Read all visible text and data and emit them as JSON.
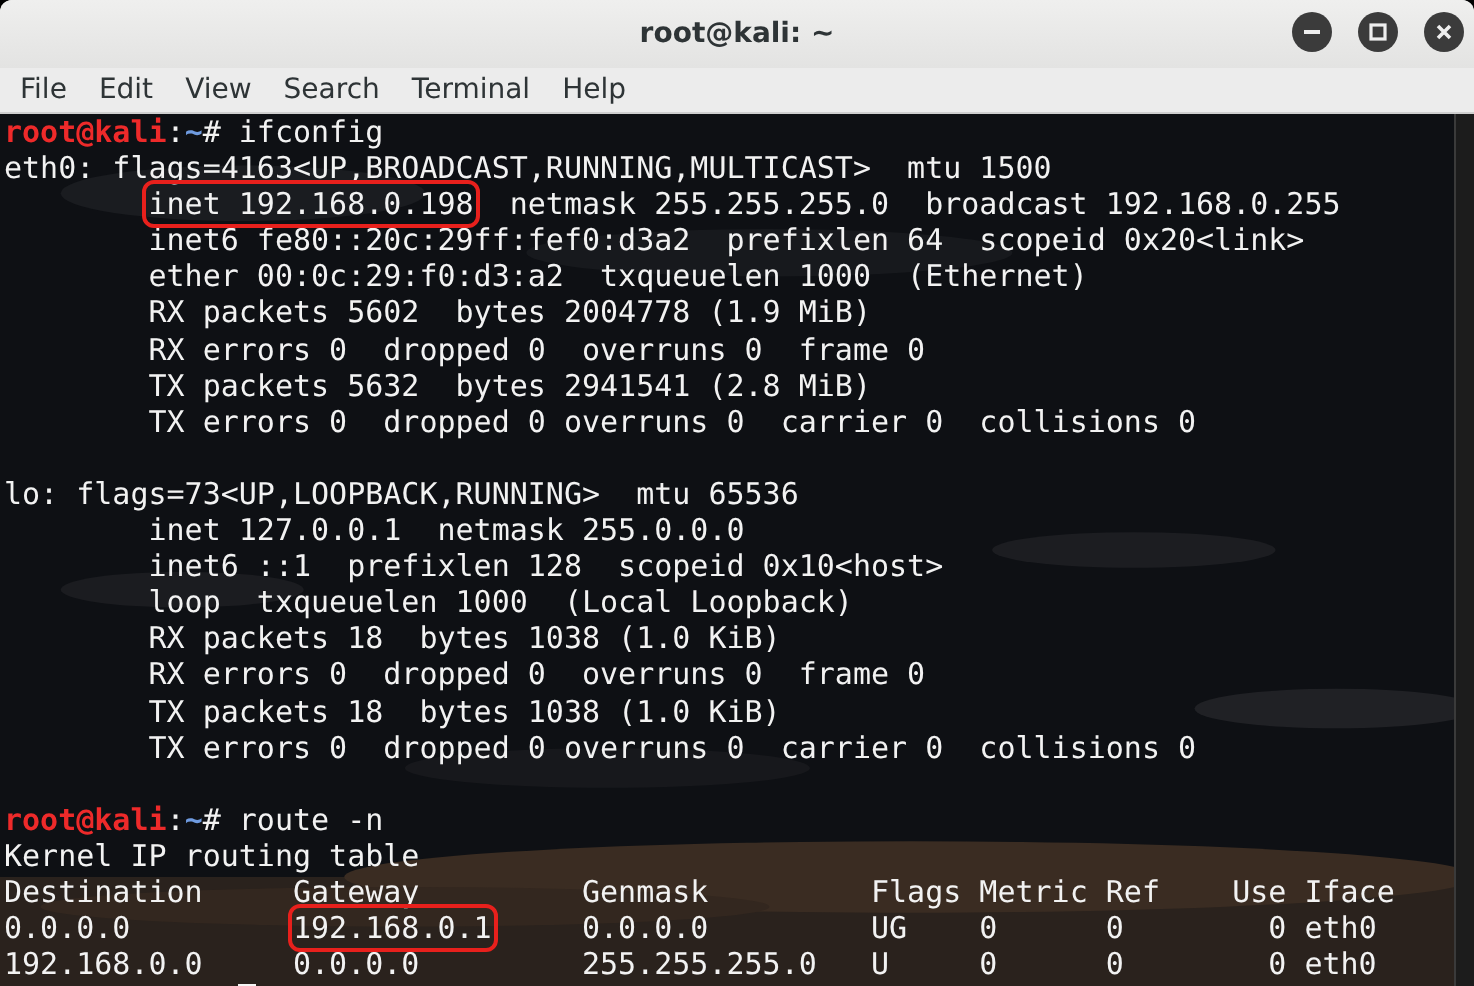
{
  "window": {
    "title": "root@kali: ~"
  },
  "menu": [
    "File",
    "Edit",
    "View",
    "Search",
    "Terminal",
    "Help"
  ],
  "terminal": {
    "lines": [
      {
        "kind": "text",
        "parts": [
          {
            "text": "root@kali",
            "color": "#ee2a2a"
          },
          {
            "text": ":"
          },
          {
            "text": "~",
            "color": "#6f9be0"
          },
          {
            "text": "# ifconfig"
          }
        ]
      },
      {
        "kind": "text",
        "parts": [
          {
            "text": "eth0: flags=4163<UP,BROADCAST,RUNNING,MULTICAST>  mtu 1500"
          }
        ]
      },
      {
        "kind": "text",
        "indented": true,
        "parts": [
          {
            "text": "inet 192.168.0.198",
            "boxed": true
          },
          {
            "text": "  netmask 255.255.255.0  broadcast 192.168.0.255"
          }
        ]
      },
      {
        "kind": "text",
        "parts": [
          {
            "text": "        inet6 fe80::20c:29ff:fef0:d3a2  prefixlen 64  scopeid 0x20<link>"
          }
        ]
      },
      {
        "kind": "text",
        "parts": [
          {
            "text": "        ether 00:0c:29:f0:d3:a2  txqueuelen 1000  (Ethernet)"
          }
        ]
      },
      {
        "kind": "text",
        "parts": [
          {
            "text": "        RX packets 5602  bytes 2004778 (1.9 MiB)"
          }
        ]
      },
      {
        "kind": "text",
        "parts": [
          {
            "text": "        RX errors 0  dropped 0  overruns 0  frame 0"
          }
        ]
      },
      {
        "kind": "text",
        "parts": [
          {
            "text": "        TX packets 5632  bytes 2941541 (2.8 MiB)"
          }
        ]
      },
      {
        "kind": "text",
        "parts": [
          {
            "text": "        TX errors 0  dropped 0 overruns 0  carrier 0  collisions 0"
          }
        ]
      },
      {
        "kind": "blank"
      },
      {
        "kind": "text",
        "parts": [
          {
            "text": "lo: flags=73<UP,LOOPBACK,RUNNING>  mtu 65536"
          }
        ]
      },
      {
        "kind": "text",
        "parts": [
          {
            "text": "        inet 127.0.0.1  netmask 255.0.0.0"
          }
        ]
      },
      {
        "kind": "text",
        "parts": [
          {
            "text": "        inet6 ::1  prefixlen 128  scopeid 0x10<host>"
          }
        ]
      },
      {
        "kind": "text",
        "parts": [
          {
            "text": "        loop  txqueuelen 1000  (Local Loopback)"
          }
        ]
      },
      {
        "kind": "text",
        "parts": [
          {
            "text": "        RX packets 18  bytes 1038 (1.0 KiB)"
          }
        ]
      },
      {
        "kind": "text",
        "parts": [
          {
            "text": "        RX errors 0  dropped 0  overruns 0  frame 0"
          }
        ]
      },
      {
        "kind": "text",
        "parts": [
          {
            "text": "        TX packets 18  bytes 1038 (1.0 KiB)"
          }
        ]
      },
      {
        "kind": "text",
        "parts": [
          {
            "text": "        TX errors 0  dropped 0 overruns 0  carrier 0  collisions 0"
          }
        ]
      },
      {
        "kind": "blank"
      },
      {
        "kind": "text",
        "parts": [
          {
            "text": "root@kali",
            "color": "#ee2a2a"
          },
          {
            "text": ":"
          },
          {
            "text": "~",
            "color": "#6f9be0"
          },
          {
            "text": "# route -n"
          }
        ]
      },
      {
        "kind": "text",
        "parts": [
          {
            "text": "Kernel IP routing table"
          }
        ]
      },
      {
        "kind": "text",
        "parts": [
          {
            "text": "Destination     Gateway         Genmask         Flags Metric Ref    Use Iface"
          }
        ]
      },
      {
        "kind": "text",
        "parts": [
          {
            "text": "0.0.0.0         "
          },
          {
            "text": "192.168.0.1",
            "boxed": true
          },
          {
            "text": "     0.0.0.0         UG    0      0        0 eth0"
          }
        ]
      },
      {
        "kind": "text",
        "parts": [
          {
            "text": "192.168.0.0     0.0.0.0         255.255.255.0   U     0      0        0 eth0"
          }
        ]
      },
      {
        "kind": "cursor"
      }
    ]
  }
}
